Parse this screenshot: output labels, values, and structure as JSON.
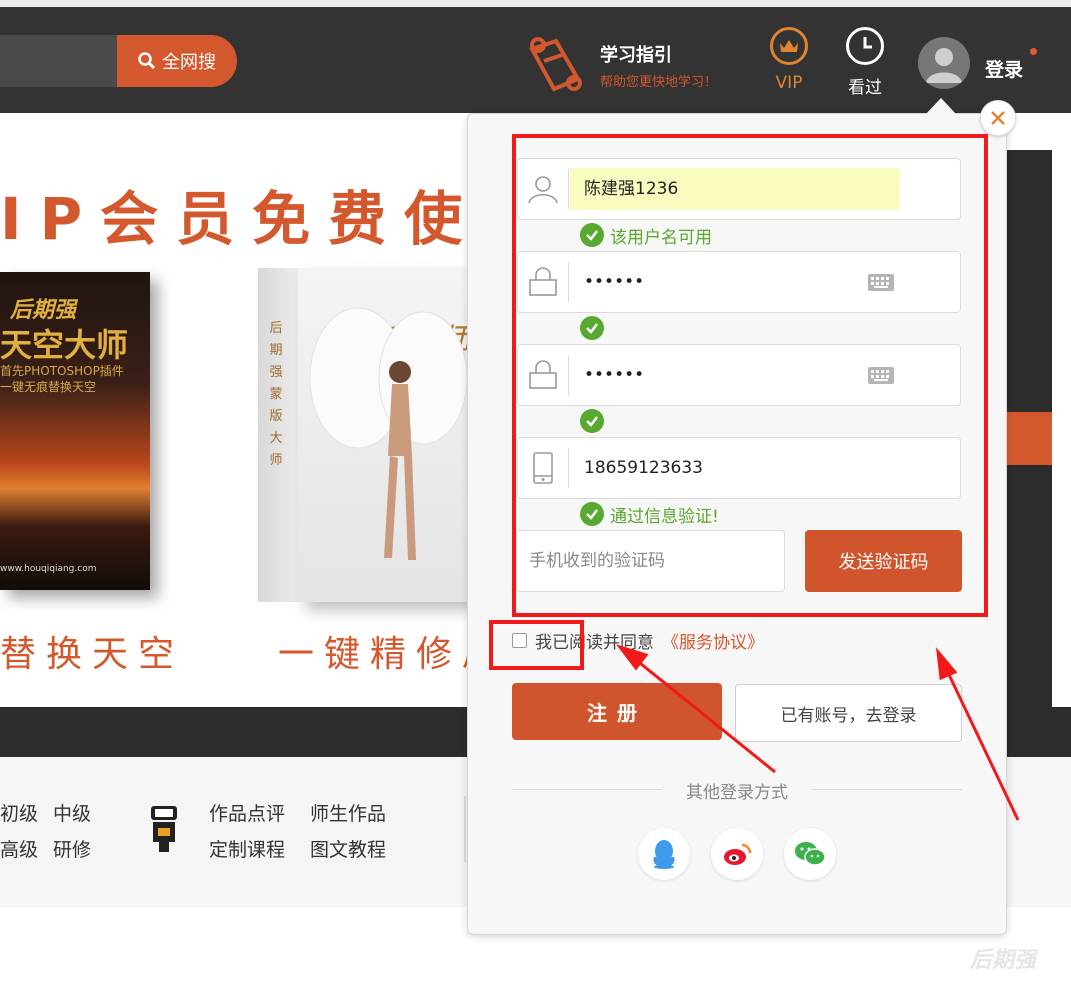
{
  "header": {
    "search_button_label": "全网搜",
    "guide_title": "学习指引",
    "guide_subtitle": "帮助您更快地学习！",
    "vip_label": "VIP",
    "history_label": "看过",
    "login_label": "登录"
  },
  "banner": {
    "title": "IP会员免费使用",
    "book1": {
      "brand": "后期强",
      "name": "天空大师",
      "line1": "首先PHOTOSHOP插件",
      "line2": "一键无痕替换天空",
      "site": "www.houqiqiang.com"
    },
    "book2": {
      "name": "蒙版大师",
      "spine": "后期强 蒙 版 大 师",
      "brand": "后"
    },
    "subtitle_left": "替换天空",
    "subtitle_right": "一键精修局"
  },
  "footer_nav": {
    "items": [
      "初级",
      "中级",
      "高级",
      "研修",
      "作品点评",
      "师生作品",
      "定制课程",
      "图文教程"
    ]
  },
  "watermark": "后期强",
  "register_popup": {
    "username_value": "陈建强1236",
    "username_status": "该用户名可用",
    "password_value": "••••••",
    "confirm_password_value": "••••••",
    "phone_value": "18659123633",
    "phone_status": "通过信息验证!",
    "sms_placeholder": "手机收到的验证码",
    "send_code_label": "发送验证码",
    "agree_text": "我已阅读并同意",
    "agree_link": "《服务协议》",
    "register_label": "注册",
    "to_login_label": "已有账号，去登录",
    "other_login_label": "其他登录方式",
    "social_icons": [
      "qq-icon",
      "weibo-icon",
      "wechat-icon"
    ]
  },
  "colors": {
    "accent": "#d4582d",
    "header_bg": "#333333",
    "valid_green": "#58a930",
    "annotation_red": "#f01a1a"
  }
}
